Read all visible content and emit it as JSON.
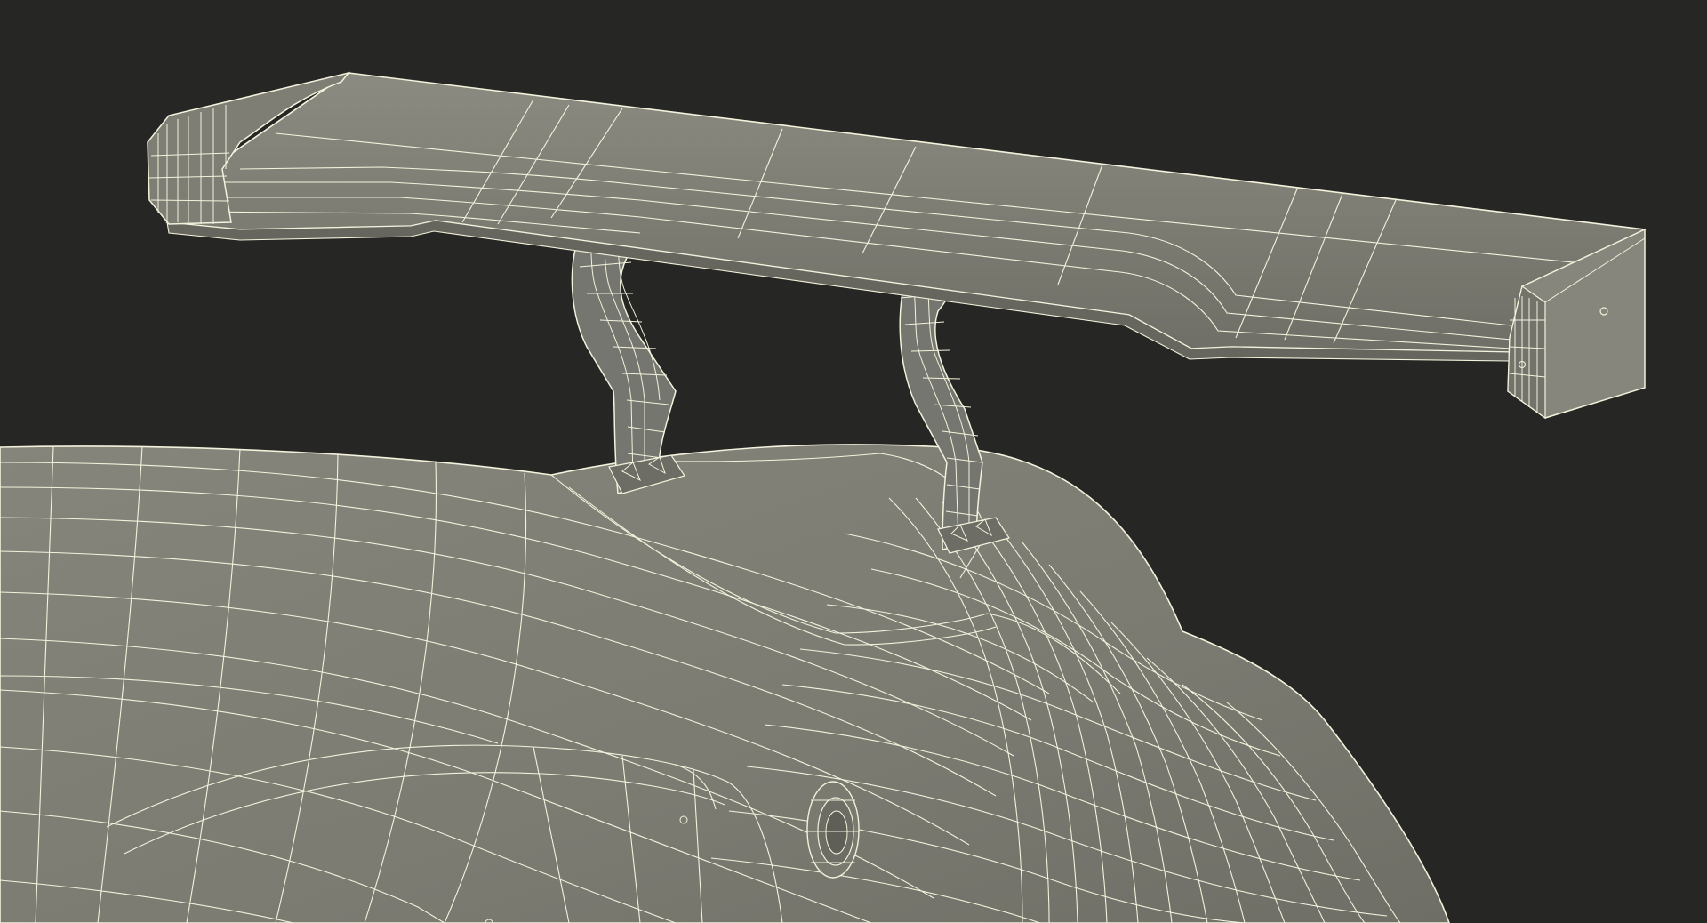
{
  "scene": {
    "subject": "wireframe-render-rear-wing",
    "colors": {
      "background": "#262624",
      "surface": "#7c7c72",
      "surface_light": "#8a8a80",
      "surface_dark": "#6a6a61",
      "wire": "#f3f2dc"
    }
  }
}
